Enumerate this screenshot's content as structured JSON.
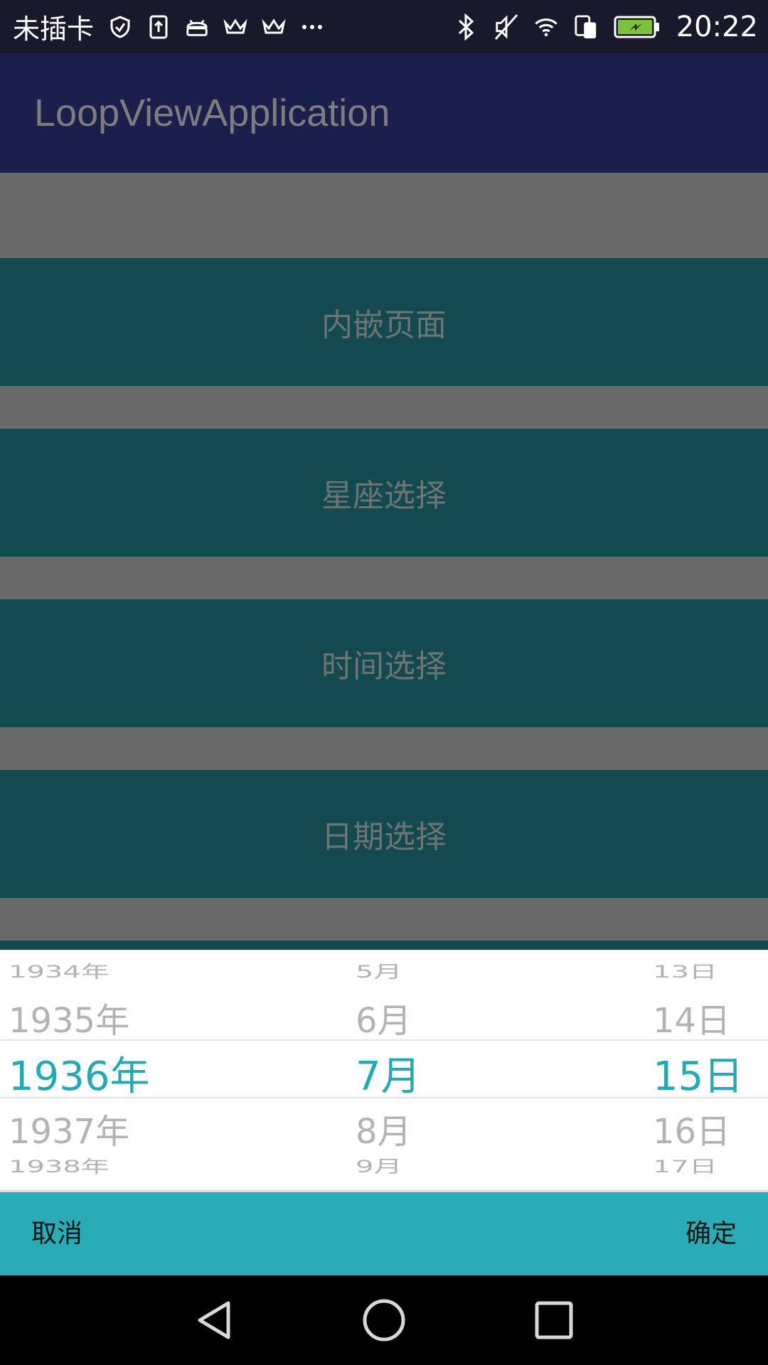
{
  "status_bar": {
    "carrier": "未插卡",
    "time": "20:22",
    "left_icons": [
      "shield-check-icon",
      "upload-icon",
      "android-icon",
      "crown-icon",
      "crown-icon",
      "more-dots-icon"
    ],
    "right_icons": [
      "bluetooth-icon",
      "muted-icon",
      "wifi-icon",
      "dual-sim-icon",
      "battery-charging-icon"
    ]
  },
  "app_bar": {
    "title": "LoopViewApplication"
  },
  "menu": {
    "items": [
      {
        "label": "内嵌页面"
      },
      {
        "label": "星座选择"
      },
      {
        "label": "时间选择"
      },
      {
        "label": "日期选择"
      }
    ]
  },
  "picker": {
    "year": {
      "items": [
        "1934年",
        "1935年",
        "1936年",
        "1937年",
        "1938年"
      ],
      "selected": "1936年"
    },
    "month": {
      "items": [
        "5月",
        "6月",
        "7月",
        "8月",
        "9月"
      ],
      "selected": "7月"
    },
    "day": {
      "items": [
        "13日",
        "14日",
        "15日",
        "16日",
        "17日"
      ],
      "selected": "15日"
    },
    "selected_color": "#25a9b5"
  },
  "actions": {
    "cancel_label": "取消",
    "confirm_label": "确定"
  },
  "colors": {
    "status_bar": "#181a2b",
    "app_bar": "#1b1f4c",
    "menu_button": "#124a50",
    "action_bar": "#2aacb7"
  }
}
